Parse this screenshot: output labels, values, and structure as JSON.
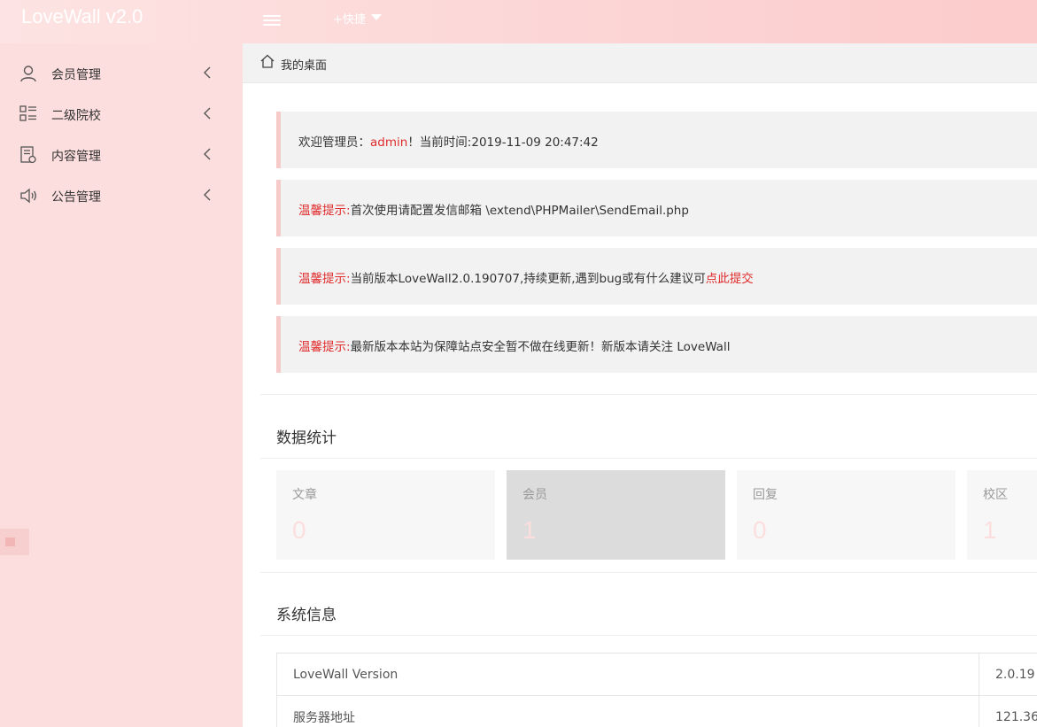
{
  "header": {
    "logo": "LoveWall v2.0",
    "quick_label": "+快捷"
  },
  "sidebar": {
    "items": [
      {
        "label": "会员管理",
        "icon": "user-icon"
      },
      {
        "label": "二级院校",
        "icon": "list-icon"
      },
      {
        "label": "内容管理",
        "icon": "document-icon"
      },
      {
        "label": "公告管理",
        "icon": "speaker-icon"
      }
    ]
  },
  "breadcrumb": {
    "label": "我的桌面"
  },
  "notices": {
    "welcome_prefix": "欢迎管理员：",
    "admin_name": "admin",
    "welcome_suffix": "！当前时间:2019-11-09 20:47:42",
    "tip_label": "温馨提示:",
    "tip1": "首次使用请配置发信邮箱 \\extend\\PHPMailer\\SendEmail.php",
    "tip2": "当前版本LoveWall2.0.190707,持续更新,遇到bug或有什么建议可",
    "tip2_link": "点此提交",
    "tip3": "最新版本本站为保障站点安全暂不做在线更新！新版本请关注 LoveWall"
  },
  "stats": {
    "title": "数据统计",
    "cards": [
      {
        "label": "文章",
        "value": "0"
      },
      {
        "label": "会员",
        "value": "1"
      },
      {
        "label": "回复",
        "value": "0"
      },
      {
        "label": "校区",
        "value": "1"
      }
    ]
  },
  "system": {
    "title": "系统信息",
    "rows": [
      {
        "key": "LoveWall Version",
        "value": "2.0.19"
      },
      {
        "key": "服务器地址",
        "value": "121.36"
      }
    ]
  },
  "colors": {
    "header_start": "#fde3e3",
    "header_end": "#fccbcb",
    "sidebar_bg": "#fcdede",
    "accent_red": "#e02b2b"
  }
}
